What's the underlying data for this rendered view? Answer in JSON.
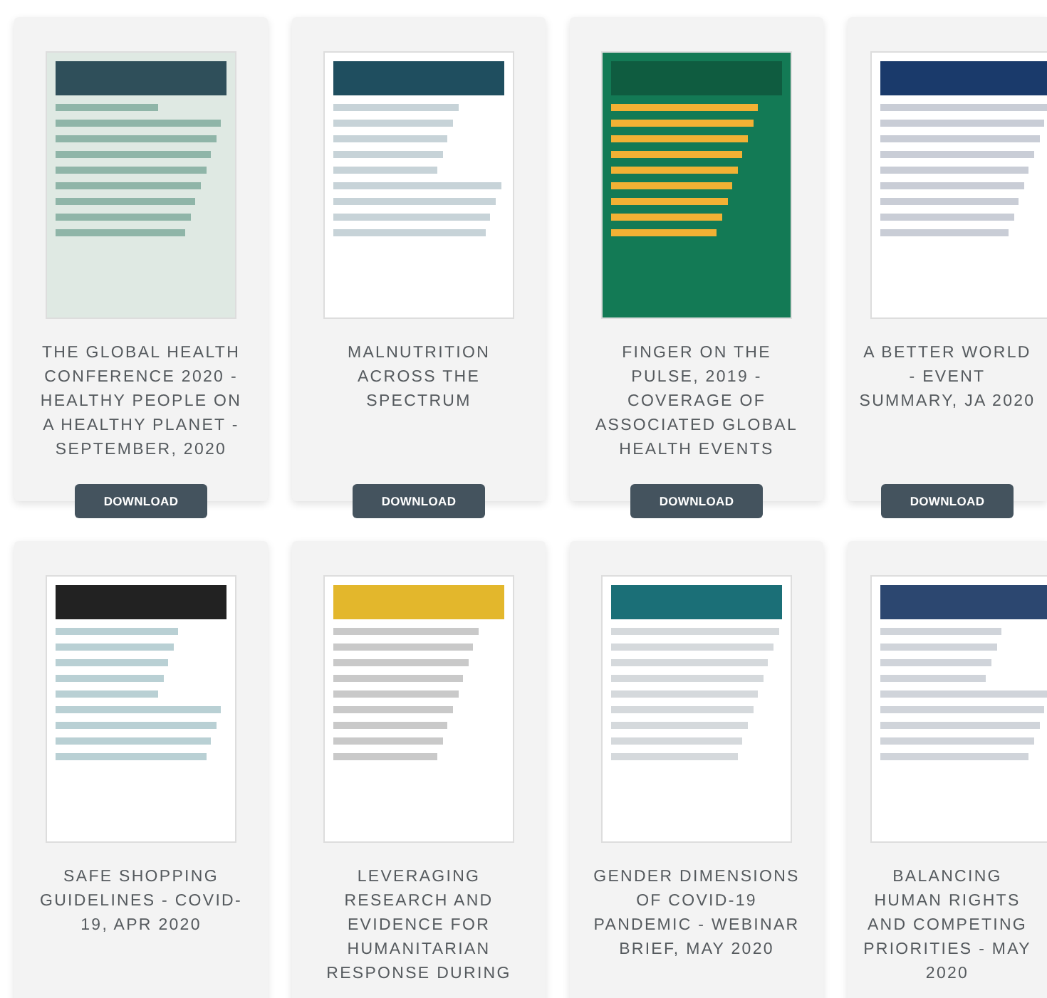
{
  "documents": [
    {
      "title": "THE GLOBAL HEALTH CONFERENCE 2020 - HEALTHY PEOPLE ON A HEALTHY PLANET - SEPTEMBER, 2020",
      "button": "DOWNLOAD"
    },
    {
      "title": "MALNUTRITION ACROSS THE SPECTRUM",
      "button": "DOWNLOAD"
    },
    {
      "title": "FINGER ON THE PULSE, 2019 - COVERAGE OF ASSOCIATED GLOBAL HEALTH EVENTS",
      "button": "DOWNLOAD"
    },
    {
      "title": "A BETTER WORLD - EVENT SUMMARY, JA 2020",
      "button": "DOWNLOAD"
    },
    {
      "title": "SAFE SHOPPING GUIDELINES - COVID-19, APR 2020"
    },
    {
      "title": "LEVERAGING RESEARCH AND EVIDENCE FOR HUMANITARIAN RESPONSE DURING"
    },
    {
      "title": "GENDER DIMENSIONS OF COVID-19 PANDEMIC - WEBINAR BRIEF, MAY 2020"
    },
    {
      "title": "BALANCING HUMAN RIGHTS AND COMPETING PRIORITIES - MAY 2020"
    }
  ]
}
